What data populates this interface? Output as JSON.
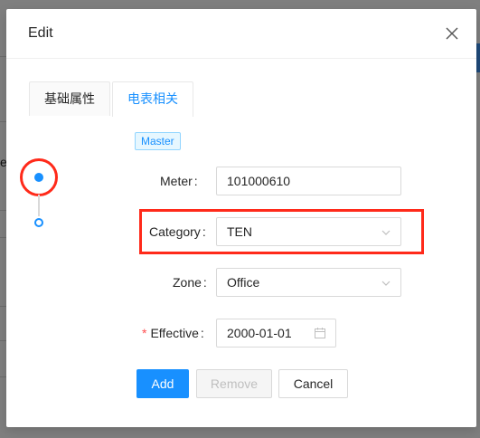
{
  "background": {
    "edge_text": "e"
  },
  "modal": {
    "title": "Edit",
    "close_icon": "close-icon"
  },
  "tabs": [
    {
      "label": "基础属性",
      "active": false
    },
    {
      "label": "电表相关",
      "active": true
    }
  ],
  "timeline": {
    "items": [
      {
        "state": "filled",
        "selected": true
      },
      {
        "state": "hollow",
        "selected": false
      }
    ]
  },
  "badge": {
    "label": "Master"
  },
  "form": {
    "meter": {
      "label": "Meter",
      "value": "101000610"
    },
    "category": {
      "label": "Category",
      "value": "TEN"
    },
    "zone": {
      "label": "Zone",
      "value": "Office"
    },
    "effective": {
      "label": "Effective",
      "value": "2000-01-01",
      "required": true
    }
  },
  "buttons": {
    "add": "Add",
    "remove": "Remove",
    "cancel": "Cancel"
  },
  "colors": {
    "primary": "#1890ff",
    "highlight": "#ff2a1a",
    "required": "#ff4d4f"
  }
}
